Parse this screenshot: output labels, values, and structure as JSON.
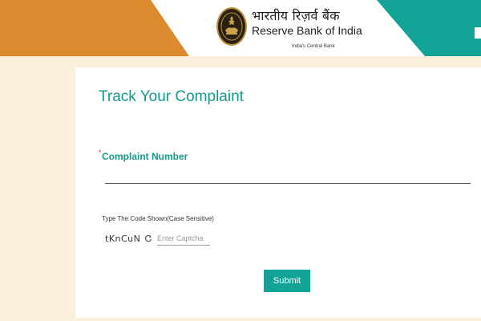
{
  "header": {
    "logo_hindi": "भारतीय रिज़र्व बैंक",
    "logo_english": "Reserve Bank of India",
    "logo_tagline": "India's Central Bank",
    "logo_icon": "rbi-seal-icon"
  },
  "form": {
    "title": "Track Your Complaint",
    "complaint_label": "Complaint Number",
    "required_marker": "*",
    "complaint_value": "",
    "captcha_label": "Type The Code Shown(Case Sensitive)",
    "captcha_code": "tKnCuN",
    "captcha_refresh_icon": "refresh-icon",
    "captcha_placeholder": "Enter Captcha",
    "submit_label": "Submit"
  },
  "colors": {
    "saffron": "#dc8a2e",
    "teal": "#11a396",
    "page_background": "#fbeedb",
    "title_text": "#17988a"
  }
}
